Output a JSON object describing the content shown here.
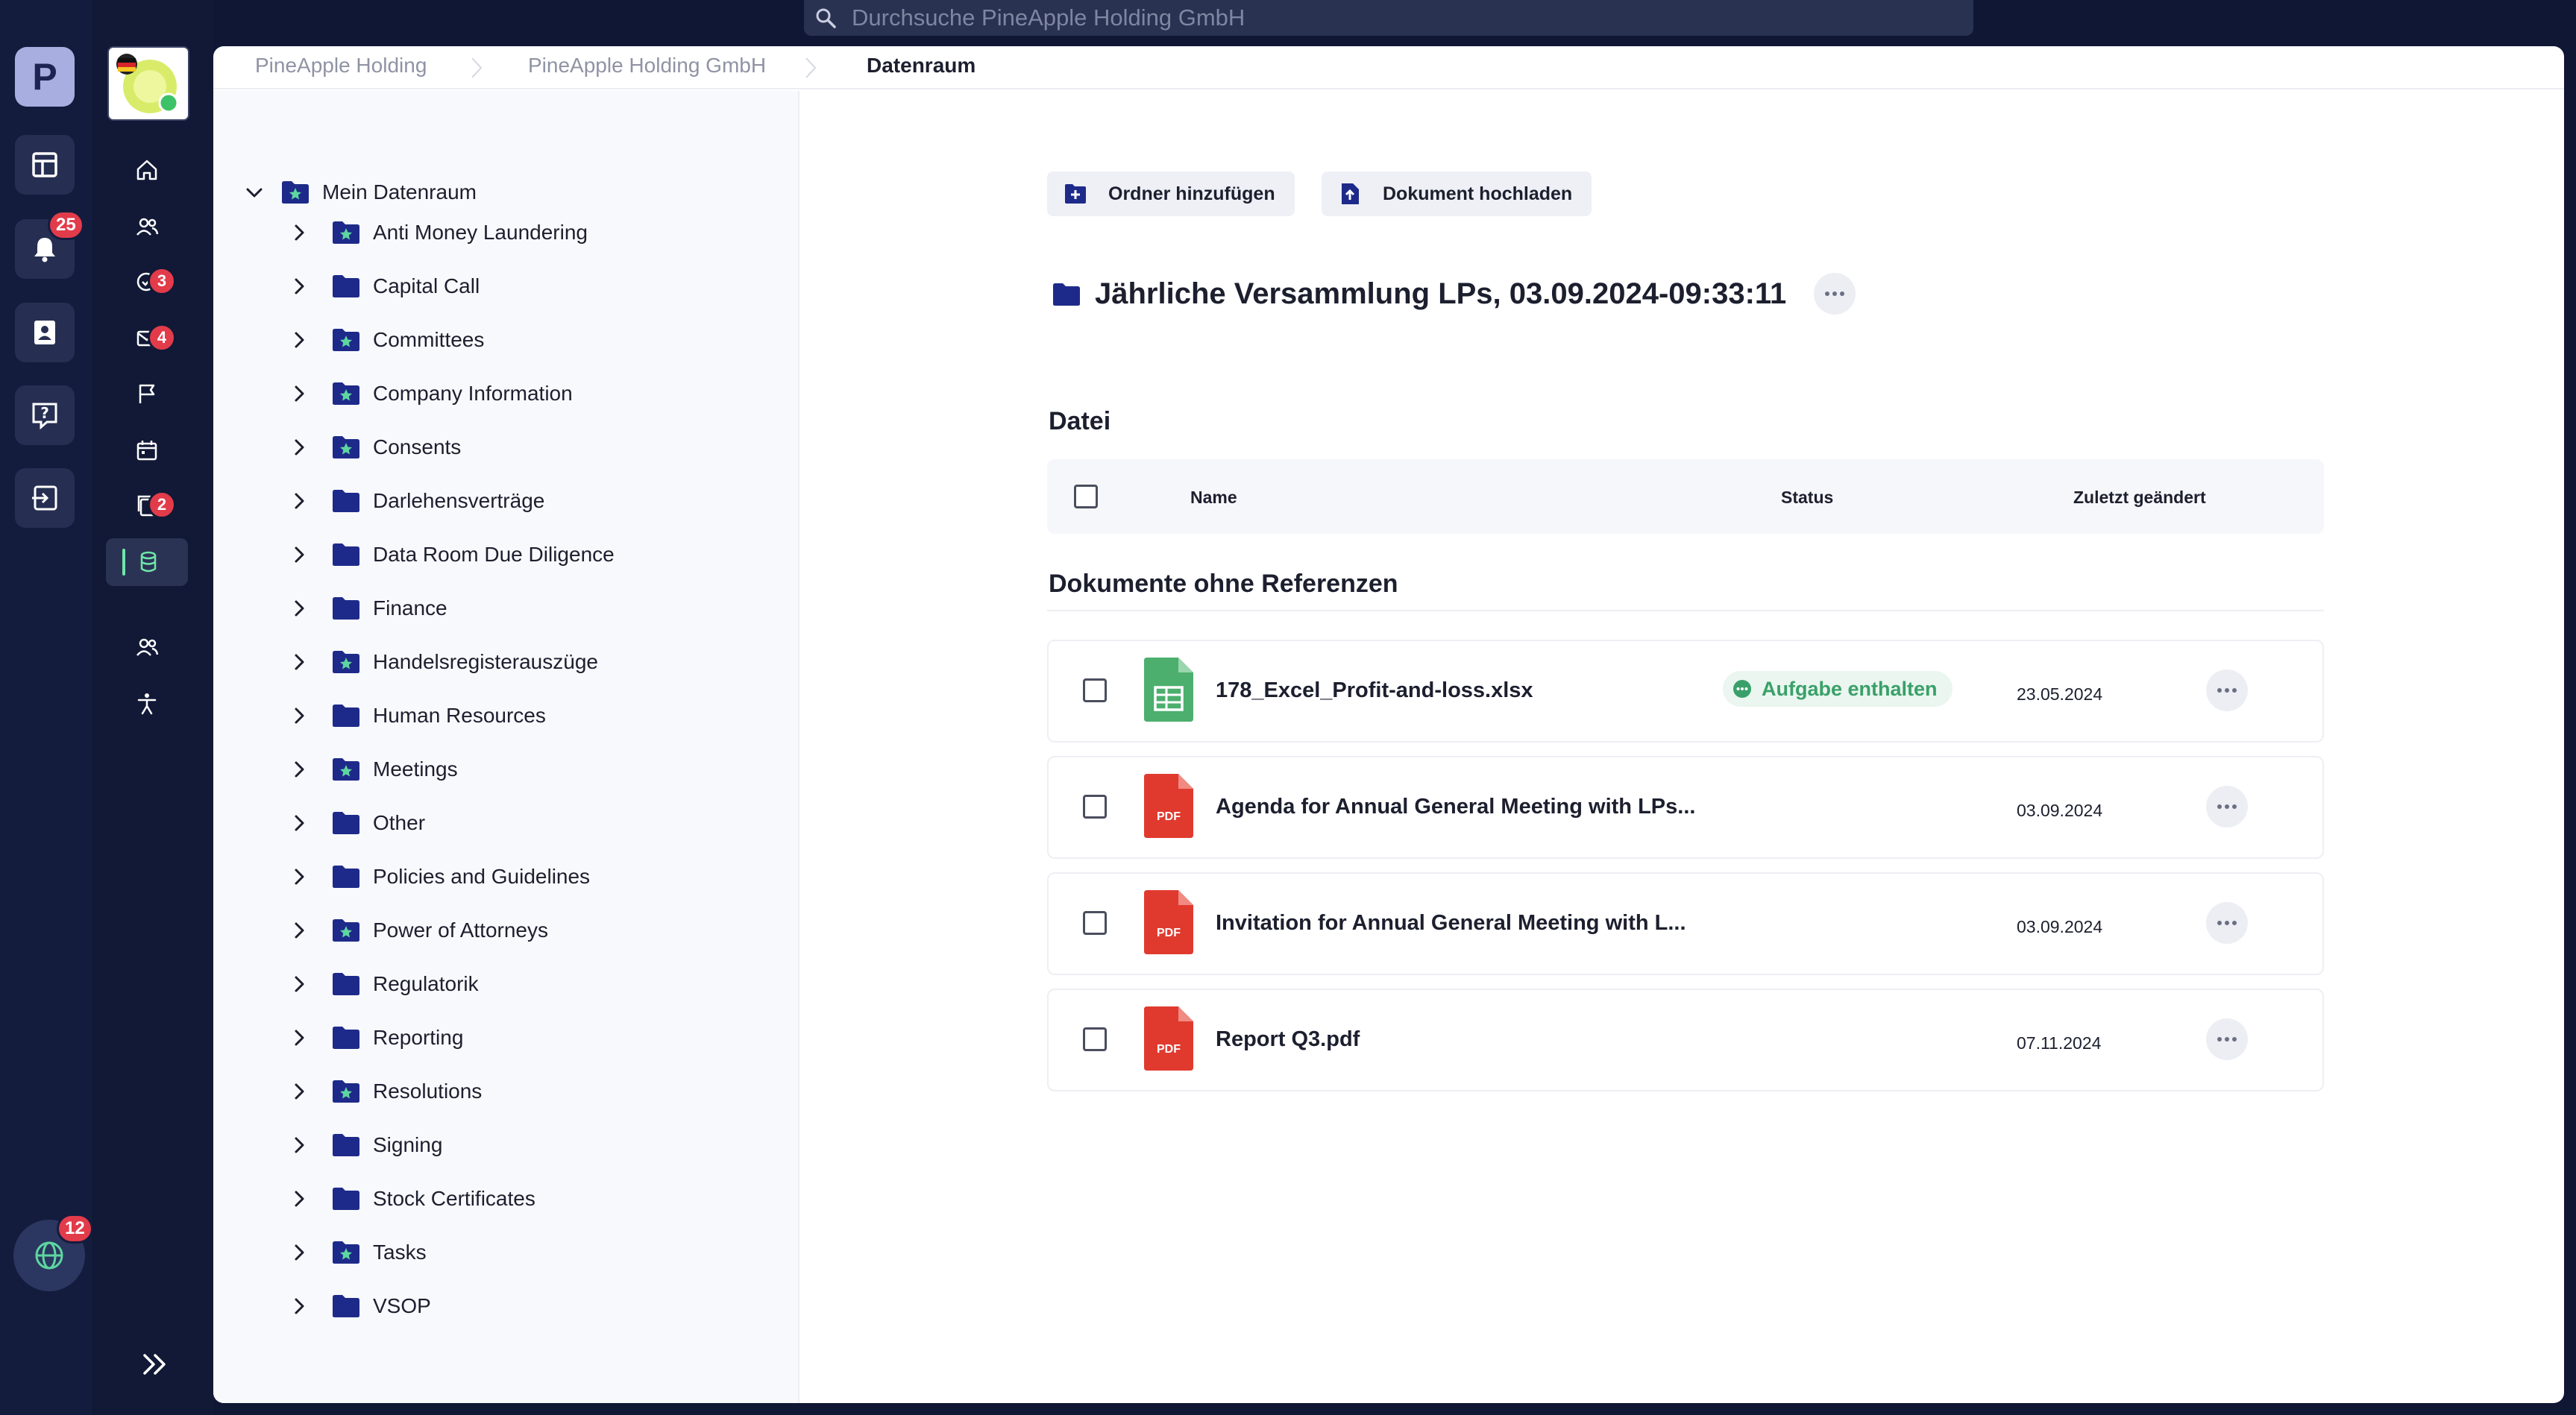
{
  "search": {
    "placeholder": "Durchsuche PineApple Holding GmbH"
  },
  "rail": {
    "avatar_letter": "P",
    "notifications_badge": "25",
    "bottom_badge": "12"
  },
  "nav2": {
    "badges": {
      "tasks": "3",
      "mail": "4",
      "documents": "2"
    }
  },
  "breadcrumb": {
    "items": [
      "PineApple Holding",
      "PineApple Holding GmbH",
      "Datenraum"
    ]
  },
  "tree": {
    "root": "Mein Datenraum",
    "items": [
      {
        "label": "Anti Money Laundering",
        "starred": true
      },
      {
        "label": "Capital Call",
        "starred": false
      },
      {
        "label": "Committees",
        "starred": true
      },
      {
        "label": "Company Information",
        "starred": true
      },
      {
        "label": "Consents",
        "starred": true
      },
      {
        "label": "Darlehensverträge",
        "starred": false
      },
      {
        "label": "Data Room Due Diligence",
        "starred": false
      },
      {
        "label": "Finance",
        "starred": false
      },
      {
        "label": "Handelsregisterauszüge",
        "starred": true
      },
      {
        "label": "Human Resources",
        "starred": false
      },
      {
        "label": "Meetings",
        "starred": true
      },
      {
        "label": "Other",
        "starred": false
      },
      {
        "label": "Policies and Guidelines",
        "starred": false
      },
      {
        "label": "Power of Attorneys",
        "starred": true
      },
      {
        "label": "Regulatorik",
        "starred": false
      },
      {
        "label": "Reporting",
        "starred": false
      },
      {
        "label": "Resolutions",
        "starred": true
      },
      {
        "label": "Signing",
        "starred": false
      },
      {
        "label": "Stock Certificates",
        "starred": false
      },
      {
        "label": "Tasks",
        "starred": true
      },
      {
        "label": "VSOP",
        "starred": false
      }
    ]
  },
  "toolbar": {
    "add_folder": "Ordner hinzufügen",
    "upload_document": "Dokument hochladen"
  },
  "folder": {
    "title": "Jährliche Versammlung LPs, 03.09.2024-09:33:11"
  },
  "table": {
    "section_title": "Datei",
    "columns": {
      "name": "Name",
      "status": "Status",
      "modified": "Zuletzt geändert"
    }
  },
  "unreferenced": {
    "section_title": "Dokumente ohne Referenzen",
    "rows": [
      {
        "name": "178_Excel_Profit-and-loss.xlsx",
        "type": "xlsx",
        "status": "Aufgabe enthalten",
        "date": "23.05.2024"
      },
      {
        "name": "Agenda for Annual General Meeting with LPs...",
        "type": "pdf",
        "status": "",
        "date": "03.09.2024"
      },
      {
        "name": "Invitation for Annual General Meeting with L...",
        "type": "pdf",
        "status": "",
        "date": "03.09.2024"
      },
      {
        "name": "Report Q3.pdf",
        "type": "pdf",
        "status": "",
        "date": "07.11.2024"
      }
    ]
  },
  "icons": {
    "pdf_label": "PDF"
  },
  "colors": {
    "accent": "#1e2a8a",
    "status_green": "#3aa06a",
    "badge_red": "#e23b4a",
    "active_bar": "#6ee7a8"
  }
}
